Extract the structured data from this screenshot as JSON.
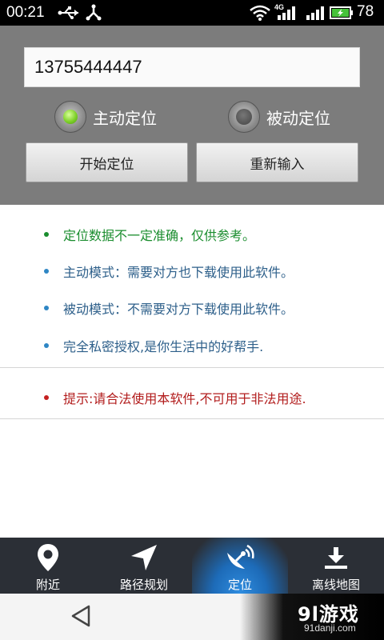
{
  "status_bar": {
    "time": "00:21",
    "network_type": "4G",
    "battery_level": "78",
    "icons": [
      "usb-icon",
      "share-icon",
      "wifi-icon",
      "signal-icon",
      "signal-icon",
      "battery-icon"
    ]
  },
  "form": {
    "phone_value": "13755444447",
    "radio_active_label": "主动定位",
    "radio_passive_label": "被动定位",
    "selected_mode": "主动定位",
    "start_button": "开始定位",
    "reset_button": "重新输入"
  },
  "info": {
    "items": [
      "定位数据不一定准确，仅供参考。",
      "主动模式：需要对方也下载使用此软件。",
      "被动模式：不需要对方下载使用此软件。",
      "完全私密授权,是你生活中的好帮手."
    ],
    "warning": "提示:请合法使用本软件,不可用于非法用途."
  },
  "nav": {
    "items": [
      {
        "label": "附近",
        "icon": "location-pin-icon"
      },
      {
        "label": "路径规划",
        "icon": "navigation-arrow-icon"
      },
      {
        "label": "定位",
        "icon": "satellite-dish-icon"
      },
      {
        "label": "离线地图",
        "icon": "download-icon"
      }
    ],
    "active": "定位"
  },
  "watermark": {
    "logo": "9l游戏",
    "site": "91danji.com"
  },
  "colors": {
    "panel_gray": "#7c7c7c",
    "green_text": "#1a8d2e",
    "blue_text": "#2d5f8a",
    "red_text": "#b21c1c",
    "nav_bg": "#2b2f36",
    "nav_active": "#2f8de0"
  }
}
